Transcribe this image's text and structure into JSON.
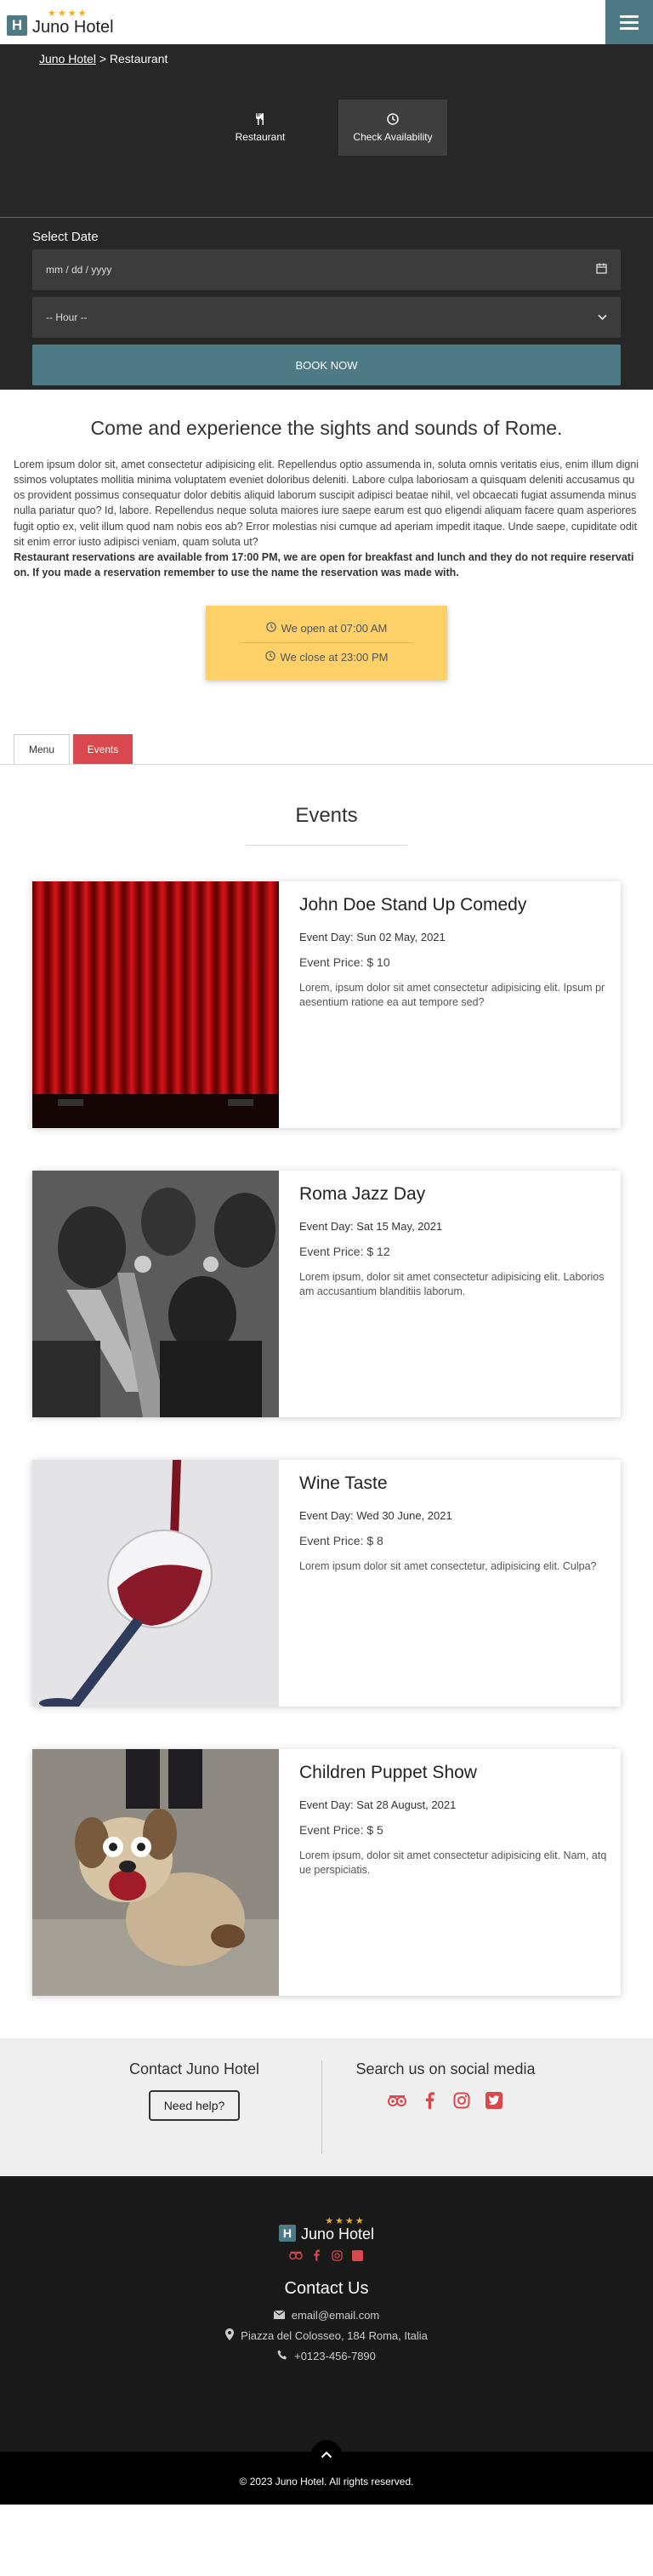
{
  "navbar": {
    "brand_name": "Juno Hotel",
    "brand_letter": "H",
    "stars": "★★★★",
    "menu_icon": "hamburger-icon"
  },
  "breadcrumb": {
    "home": "Juno Hotel",
    "separator": " > ",
    "current": "Restaurant"
  },
  "hero_tabs": [
    {
      "label": "Restaurant",
      "icon": "utensils-icon"
    },
    {
      "label": "Check Availability",
      "icon": "clock-icon"
    }
  ],
  "booking": {
    "date_label": "Select Date",
    "date_placeholder": "mm / dd / yyyy",
    "hour_value": "-- Hour --",
    "book_button": "BOOK NOW"
  },
  "intro": {
    "title": "Come and experience the sights and sounds of Rome.",
    "paragraph": "Lorem ipsum dolor sit, amet consectetur adipisicing elit. Repellendus optio assumenda in, soluta omnis veritatis eius, enim illum dignissimos voluptates mollitia minima voluptatem eveniet doloribus deleniti. Labore culpa laboriosam a quisquam deleniti accusamus quos provident possimus consequatur dolor debitis aliquid laborum suscipit adipisci beatae nihil, vel obcaecati fugiat assumenda minus nulla pariatur quo? Id, labore. Repellendus neque soluta maiores iure saepe earum est quo eligendi aliquam facere quam asperiores fugit optio ex, velit illum quod nam nobis eos ab? Error molestias nisi cumque ad aperiam impedit itaque. Unde saepe, cupiditate odit sit enim error iusto adipisci veniam, quam soluta ut?",
    "bold": "Restaurant reservations are available from 17:00 PM, we are open for breakfast and lunch and they do not require reservation. If you made a reservation remember to use the name the reservation was made with.",
    "open": "We open at 07:00 AM",
    "close": "We close at 23:00 PM"
  },
  "page_tabs": {
    "menu": "Menu",
    "events": "Events"
  },
  "events_title": "Events",
  "events": [
    {
      "title": "John Doe Stand Up Comedy",
      "day_label": "Event Day:",
      "day": "Sun 02 May, 2021",
      "price_label": "Event Price:",
      "price": "$ 10",
      "desc": "Lorem, ipsum dolor sit amet consectetur adipisicing elit. Ipsum praesentium ratione ea aut tempore sed?",
      "image": "red-curtain-stage"
    },
    {
      "title": "Roma Jazz Day",
      "day_label": "Event Day:",
      "day": "Sat 15 May, 2021",
      "price_label": "Event Price:",
      "price": "$ 12",
      "desc": "Lorem ipsum, dolor sit amet consectetur adipisicing elit. Laboriosam accusantium blanditiis laborum.",
      "image": "jazz-musicians-mural"
    },
    {
      "title": "Wine Taste",
      "day_label": "Event Day:",
      "day": "Wed 30 June, 2021",
      "price_label": "Event Price:",
      "price": "$ 8",
      "desc": "Lorem ipsum dolor sit amet consectetur, adipisicing elit. Culpa?",
      "image": "wine-glass-pour"
    },
    {
      "title": "Children Puppet Show",
      "day_label": "Event Day:",
      "day": "Sat 28 August, 2021",
      "price_label": "Event Price:",
      "price": "$ 5",
      "desc": "Lorem ipsum, dolor sit amet consectetur adipisicing elit. Nam, atque perspiciatis.",
      "image": "dog-puppet"
    }
  ],
  "contact": {
    "title": "Contact Juno Hotel",
    "help_button": "Need help?",
    "social_title": "Search us on social media"
  },
  "footer": {
    "brand_name": "Juno Hotel",
    "brand_letter": "H",
    "stars": "★★★★",
    "contact_title": "Contact Us",
    "email": "email@email.com",
    "address": "Piazza del Colosseo, 184 Roma, Italia",
    "phone": "+0123-456-7890",
    "copyright": "© 2023 Juno Hotel. All rights reserved."
  },
  "colors": {
    "accent": "#4e7a86",
    "red": "#d9484c",
    "gold": "#f0ad1e",
    "dark": "#272727"
  }
}
